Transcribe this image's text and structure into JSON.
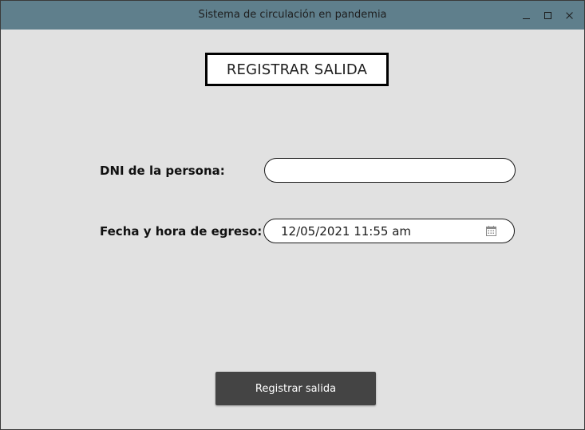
{
  "window": {
    "title": "Sistema de circulación en pandemia",
    "controls": {
      "minimize_icon": "minimize-icon",
      "maximize_icon": "maximize-icon",
      "close_icon": "close-icon"
    },
    "titlebar_color": "#5f7f8c",
    "background_color": "#e1e1e1"
  },
  "main": {
    "heading": "REGISTRAR SALIDA",
    "dni": {
      "label": "DNI de la persona:",
      "value": "",
      "placeholder": ""
    },
    "fecha": {
      "label": "Fecha y hora de egreso:",
      "value": "12/05/2021 11:55 am",
      "icon": "calendar-icon"
    },
    "submit_label": "Registrar salida",
    "submit_color": "#444444"
  }
}
